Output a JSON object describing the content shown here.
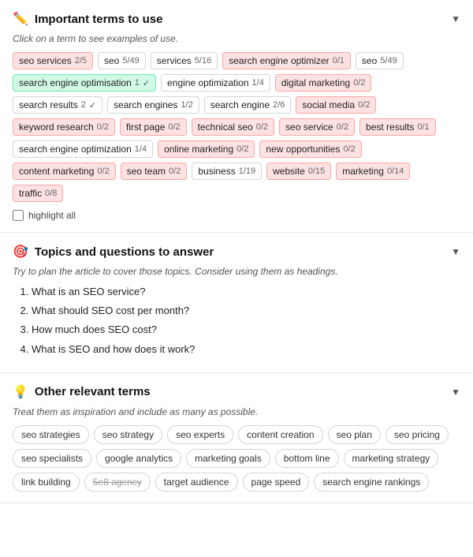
{
  "importantTerms": {
    "sectionTitle": "Important terms to use",
    "subtitle": "Click on a term to see examples of use.",
    "icon": "✏️",
    "terms": [
      {
        "label": "seo services",
        "count": "2/5",
        "style": "red"
      },
      {
        "label": "seo",
        "count": "5/49",
        "style": "default"
      },
      {
        "label": "services",
        "count": "5/16",
        "style": "default"
      },
      {
        "label": "search engine optimizer",
        "count": "0/1",
        "style": "red"
      },
      {
        "label": "seo",
        "count": "5/49",
        "style": "default"
      },
      {
        "label": "search engine optimisation",
        "count": "1",
        "check": "✓",
        "style": "green"
      },
      {
        "label": "engine optimization",
        "count": "1/4",
        "style": "default"
      },
      {
        "label": "digital marketing",
        "count": "0/2",
        "style": "red"
      },
      {
        "label": "search results",
        "count": "2",
        "check": "✓",
        "style": "default"
      },
      {
        "label": "search engines",
        "count": "1/2",
        "style": "default"
      },
      {
        "label": "search engine",
        "count": "2/6",
        "style": "default"
      },
      {
        "label": "social media",
        "count": "0/2",
        "style": "red"
      },
      {
        "label": "keyword research",
        "count": "0/2",
        "style": "red"
      },
      {
        "label": "first page",
        "count": "0/2",
        "style": "red"
      },
      {
        "label": "technical seo",
        "count": "0/2",
        "style": "red"
      },
      {
        "label": "seo service",
        "count": "0/2",
        "style": "red"
      },
      {
        "label": "best results",
        "count": "0/1",
        "style": "red"
      },
      {
        "label": "search engine optimization",
        "count": "1/4",
        "style": "default"
      },
      {
        "label": "online marketing",
        "count": "0/2",
        "style": "red"
      },
      {
        "label": "new opportunities",
        "count": "0/2",
        "style": "red"
      },
      {
        "label": "content marketing",
        "count": "0/2",
        "style": "red"
      },
      {
        "label": "seo team",
        "count": "0/2",
        "style": "red"
      },
      {
        "label": "business",
        "count": "1/19",
        "style": "default"
      },
      {
        "label": "website",
        "count": "0/15",
        "style": "red"
      },
      {
        "label": "marketing",
        "count": "0/14",
        "style": "red"
      },
      {
        "label": "traffic",
        "count": "0/8",
        "style": "red"
      }
    ],
    "highlightAll": "highlight all"
  },
  "topicsSection": {
    "sectionTitle": "Topics and questions to answer",
    "icon": "🎯",
    "subtitle": "Try to plan the article to cover those topics. Consider using them as headings.",
    "questions": [
      "What is an SEO service?",
      "What should SEO cost per month?",
      "How much does SEO cost?",
      "What is SEO and how does it work?"
    ]
  },
  "otherTermsSection": {
    "sectionTitle": "Other relevant terms",
    "icon": "💡",
    "subtitle": "Treat them as inspiration and include as many as possible.",
    "terms": [
      {
        "label": "seo strategies",
        "strikethrough": false
      },
      {
        "label": "seo strategy",
        "strikethrough": false
      },
      {
        "label": "seo experts",
        "strikethrough": false
      },
      {
        "label": "content creation",
        "strikethrough": false
      },
      {
        "label": "seo plan",
        "strikethrough": false
      },
      {
        "label": "seo pricing",
        "strikethrough": false
      },
      {
        "label": "seo specialists",
        "strikethrough": false
      },
      {
        "label": "google analytics",
        "strikethrough": false
      },
      {
        "label": "marketing goals",
        "strikethrough": false
      },
      {
        "label": "bottom line",
        "strikethrough": false
      },
      {
        "label": "marketing strategy",
        "strikethrough": false
      },
      {
        "label": "link building",
        "strikethrough": false
      },
      {
        "label": "5e8 agency",
        "strikethrough": true
      },
      {
        "label": "target audience",
        "strikethrough": false
      },
      {
        "label": "page speed",
        "strikethrough": false
      },
      {
        "label": "search engine rankings",
        "strikethrough": false
      }
    ]
  }
}
